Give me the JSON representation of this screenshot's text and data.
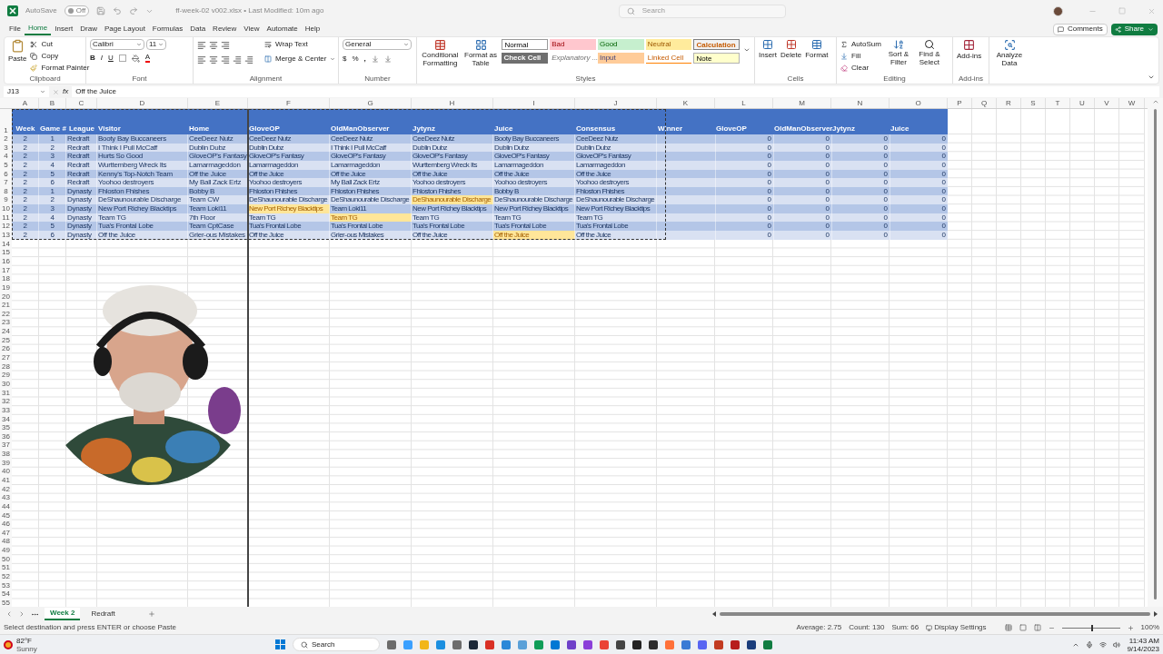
{
  "title_bar": {
    "autosave_label": "AutoSave",
    "autosave": {
      "label": "Off",
      "on": false
    },
    "filename": "ff-week-02 v002.xlsx • Last Modified: 10m ago",
    "search_placeholder": "Search"
  },
  "menu_tabs": [
    {
      "label": "File",
      "selected": false
    },
    {
      "label": "Home",
      "selected": true
    },
    {
      "label": "Insert",
      "selected": false
    },
    {
      "label": "Draw",
      "selected": false
    },
    {
      "label": "Page Layout",
      "selected": false
    },
    {
      "label": "Formulas",
      "selected": false
    },
    {
      "label": "Data",
      "selected": false
    },
    {
      "label": "Review",
      "selected": false
    },
    {
      "label": "View",
      "selected": false
    },
    {
      "label": "Automate",
      "selected": false
    },
    {
      "label": "Help",
      "selected": false
    }
  ],
  "comments": "Comments",
  "share": "Share",
  "ribbon": {
    "clipboard": {
      "paste": "Paste",
      "cut": "Cut",
      "copy": "Copy",
      "format_painter": "Format Painter",
      "label": "Clipboard"
    },
    "font": {
      "name": "Calibri",
      "size": "11",
      "bold": "B",
      "italic": "I",
      "underline": "U",
      "color_letter": "A",
      "label": "Font"
    },
    "alignment": {
      "wrap": "Wrap Text",
      "merge": "Merge & Center",
      "label": "Alignment"
    },
    "number": {
      "format": "General",
      "currency": "$",
      "percent": "%",
      "comma": ",",
      "label": "Number"
    },
    "styles": {
      "conditional": "Conditional Formatting",
      "format_table": "Format as Table",
      "label": "Styles",
      "cells": [
        {
          "label": "Normal",
          "kind": "normal"
        },
        {
          "label": "Bad",
          "kind": "bad"
        },
        {
          "label": "Good",
          "kind": "good"
        },
        {
          "label": "Neutral",
          "kind": "neutral"
        },
        {
          "label": "Calculation",
          "kind": "calculation"
        },
        {
          "label": "Check Cell",
          "kind": "check"
        },
        {
          "label": "Explanatory ...",
          "kind": "explanatory"
        },
        {
          "label": "Input",
          "kind": "input"
        },
        {
          "label": "Linked Cell",
          "kind": "linked"
        },
        {
          "label": "Note",
          "kind": "note"
        }
      ]
    },
    "cells": {
      "insert": "Insert",
      "delete": "Delete",
      "format": "Format",
      "label": "Cells"
    },
    "editing": {
      "autosum": "AutoSum",
      "fill": "Fill",
      "clear": "Clear",
      "sort": "Sort & Filter",
      "find": "Find & Select",
      "label": "Editing"
    },
    "addins": {
      "addins": "Add-ins",
      "label": "Add-ins"
    },
    "analyze": "Analyze Data"
  },
  "formula_bar": {
    "name_box": "J13",
    "fx": "fx",
    "value": "Off the Juice"
  },
  "sheet": {
    "column_letters": [
      "A",
      "B",
      "C",
      "D",
      "E",
      "F",
      "G",
      "H",
      "I",
      "J",
      "K",
      "L",
      "M",
      "N",
      "O",
      "P",
      "Q",
      "R",
      "S",
      "T",
      "U",
      "V",
      "W"
    ],
    "row_numbers": [
      "1",
      "2",
      "3",
      "4",
      "5",
      "6",
      "7",
      "8",
      "9",
      "10",
      "11",
      "12",
      "13",
      "14",
      "15",
      "16",
      "17",
      "18",
      "19",
      "20",
      "21",
      "22",
      "23",
      "24",
      "25",
      "26",
      "27",
      "28",
      "29",
      "30",
      "31",
      "32",
      "33",
      "34",
      "35",
      "36",
      "37",
      "38",
      "39",
      "40",
      "41",
      "42",
      "43",
      "44",
      "45",
      "46",
      "47",
      "48",
      "49",
      "50",
      "51",
      "52",
      "53",
      "54",
      "55"
    ],
    "headers": [
      "Week",
      "Game #",
      "League",
      "Visitor",
      "Home",
      "GloveOP",
      "OldManObserver",
      "Jytynz",
      "Juice",
      "Consensus",
      "Winner",
      "GloveOP",
      "OldManObserver",
      "Jytynz",
      "Juice"
    ],
    "rows": [
      {
        "cells": [
          "2",
          "1",
          "Redraft",
          "Booty Bay Buccaneers",
          "CeeDeez Nutz"
        ],
        "picks": [
          {
            "text": "CeeDeez Nutz",
            "highlighted": false
          },
          {
            "text": "CeeDeez Nutz",
            "highlighted": false
          },
          {
            "text": "CeeDeez Nutz",
            "highlighted": false
          },
          {
            "text": "Booty Bay Buccaneers",
            "highlighted": false
          },
          {
            "text": "CeeDeez Nutz",
            "highlighted": false
          }
        ],
        "points": [
          "0",
          "0",
          "0",
          "0"
        ]
      },
      {
        "cells": [
          "2",
          "2",
          "Redraft",
          "I Think I Pull McCaff",
          "Dublin Dubz"
        ],
        "picks": [
          {
            "text": "Dublin Dubz",
            "highlighted": false
          },
          {
            "text": "I Think I Pull McCaff",
            "highlighted": false
          },
          {
            "text": "Dublin Dubz",
            "highlighted": false
          },
          {
            "text": "Dublin Dubz",
            "highlighted": false
          },
          {
            "text": "Dublin Dubz",
            "highlighted": false
          }
        ],
        "points": [
          "0",
          "0",
          "0",
          "0"
        ]
      },
      {
        "cells": [
          "2",
          "3",
          "Redraft",
          "Hurts So Good",
          "GloveOP's Fantasy"
        ],
        "picks": [
          {
            "text": "GloveOP's Fantasy",
            "highlighted": false
          },
          {
            "text": "GloveOP's Fantasy",
            "highlighted": false
          },
          {
            "text": "GloveOP's Fantasy",
            "highlighted": false
          },
          {
            "text": "GloveOP's Fantasy",
            "highlighted": false
          },
          {
            "text": "GloveOP's Fantasy",
            "highlighted": false
          }
        ],
        "points": [
          "0",
          "0",
          "0",
          "0"
        ]
      },
      {
        "cells": [
          "2",
          "4",
          "Redraft",
          "Wurttemberg Wreck Its",
          "Lamarmageddon"
        ],
        "picks": [
          {
            "text": "Lamarmageddon",
            "highlighted": false
          },
          {
            "text": "Lamarmageddon",
            "highlighted": false
          },
          {
            "text": "Wurttemberg Wreck Its",
            "highlighted": false
          },
          {
            "text": "Lamarmageddon",
            "highlighted": false
          },
          {
            "text": "Lamarmageddon",
            "highlighted": false
          }
        ],
        "points": [
          "0",
          "0",
          "0",
          "0"
        ]
      },
      {
        "cells": [
          "2",
          "5",
          "Redraft",
          "Kenny's Top-Notch Team",
          "Off the Juice"
        ],
        "picks": [
          {
            "text": "Off the Juice",
            "highlighted": false
          },
          {
            "text": "Off the Juice",
            "highlighted": false
          },
          {
            "text": "Off the Juice",
            "highlighted": false
          },
          {
            "text": "Off the Juice",
            "highlighted": false
          },
          {
            "text": "Off the Juice",
            "highlighted": false
          }
        ],
        "points": [
          "0",
          "0",
          "0",
          "0"
        ]
      },
      {
        "cells": [
          "2",
          "6",
          "Redraft",
          "Yoohoo destroyers",
          "My Ball Zack Ertz"
        ],
        "picks": [
          {
            "text": "Yoohoo destroyers",
            "highlighted": false
          },
          {
            "text": "My Ball Zack Ertz",
            "highlighted": false
          },
          {
            "text": "Yoohoo destroyers",
            "highlighted": false
          },
          {
            "text": "Yoohoo destroyers",
            "highlighted": false
          },
          {
            "text": "Yoohoo destroyers",
            "highlighted": false
          }
        ],
        "points": [
          "0",
          "0",
          "0",
          "0"
        ]
      },
      {
        "cells": [
          "2",
          "1",
          "Dynasty",
          "Fhloston Fhishes",
          "Bobby B"
        ],
        "picks": [
          {
            "text": "Fhloston Fhishes",
            "highlighted": false
          },
          {
            "text": "Fhloston Fhishes",
            "highlighted": false
          },
          {
            "text": "Fhloston Fhishes",
            "highlighted": false
          },
          {
            "text": "Bobby B",
            "highlighted": false
          },
          {
            "text": "Fhloston Fhishes",
            "highlighted": false
          }
        ],
        "points": [
          "0",
          "0",
          "0",
          "0"
        ]
      },
      {
        "cells": [
          "2",
          "2",
          "Dynasty",
          "DeShaunourable Discharge",
          "Team CW"
        ],
        "picks": [
          {
            "text": "DeShaunourable Discharge",
            "highlighted": false
          },
          {
            "text": "DeShaunourable Discharge",
            "highlighted": false
          },
          {
            "text": "DeShaunourable Discharge",
            "highlighted": true
          },
          {
            "text": "DeShaunourable Discharge",
            "highlighted": false
          },
          {
            "text": "DeShaunourable Discharge",
            "highlighted": false
          }
        ],
        "points": [
          "0",
          "0",
          "0",
          "0"
        ]
      },
      {
        "cells": [
          "2",
          "3",
          "Dynasty",
          "New Port Richey Blacktips",
          "Team Loki11"
        ],
        "picks": [
          {
            "text": "New Port Richey Blacktips",
            "highlighted": true
          },
          {
            "text": "Team Loki11",
            "highlighted": false
          },
          {
            "text": "New Port Richey Blacktips",
            "highlighted": false
          },
          {
            "text": "New Port Richey Blacktips",
            "highlighted": false
          },
          {
            "text": "New Port Richey Blacktips",
            "highlighted": false
          }
        ],
        "points": [
          "0",
          "0",
          "0",
          "0"
        ]
      },
      {
        "cells": [
          "2",
          "4",
          "Dynasty",
          "Team TG",
          "7th Floor"
        ],
        "picks": [
          {
            "text": "Team TG",
            "highlighted": false
          },
          {
            "text": "Team TG",
            "highlighted": true
          },
          {
            "text": "Team TG",
            "highlighted": false
          },
          {
            "text": "Team TG",
            "highlighted": false
          },
          {
            "text": "Team TG",
            "highlighted": false
          }
        ],
        "points": [
          "0",
          "0",
          "0",
          "0"
        ]
      },
      {
        "cells": [
          "2",
          "5",
          "Dynasty",
          "Tua's Frontal Lobe",
          "Team CptCase"
        ],
        "picks": [
          {
            "text": "Tua's Frontal Lobe",
            "highlighted": false
          },
          {
            "text": "Tua's Frontal Lobe",
            "highlighted": false
          },
          {
            "text": "Tua's Frontal Lobe",
            "highlighted": false
          },
          {
            "text": "Tua's Frontal Lobe",
            "highlighted": false
          },
          {
            "text": "Tua's Frontal Lobe",
            "highlighted": false
          }
        ],
        "points": [
          "0",
          "0",
          "0",
          "0"
        ]
      },
      {
        "cells": [
          "2",
          "6",
          "Dynasty",
          "Off the Juice",
          "Grier-ous Mistakes"
        ],
        "picks": [
          {
            "text": "Off the Juice",
            "highlighted": false
          },
          {
            "text": "Grier-ous Mistakes",
            "highlighted": false
          },
          {
            "text": "Off the Juice",
            "highlighted": false
          },
          {
            "text": "Off the Juice",
            "highlighted": true
          },
          {
            "text": "Off the Juice",
            "highlighted": false
          }
        ],
        "points": [
          "0",
          "0",
          "0",
          "0"
        ]
      }
    ]
  },
  "sheet_tabs": [
    {
      "label": "Week 2",
      "selected": true
    },
    {
      "label": "Redraft",
      "selected": false
    }
  ],
  "status_bar": {
    "message": "Select destination and press ENTER or choose Paste",
    "average": "Average: 2.75",
    "count": "Count: 130",
    "sum": "Sum: 66",
    "display": "Display Settings",
    "zoom_slider": {
      "level": 0.5
    },
    "zoom": "100%"
  },
  "taskbar": {
    "temperature": "82°F",
    "weather": "Sunny",
    "search": "Search",
    "time": "11:43 AM",
    "date": "9/14/2023"
  }
}
